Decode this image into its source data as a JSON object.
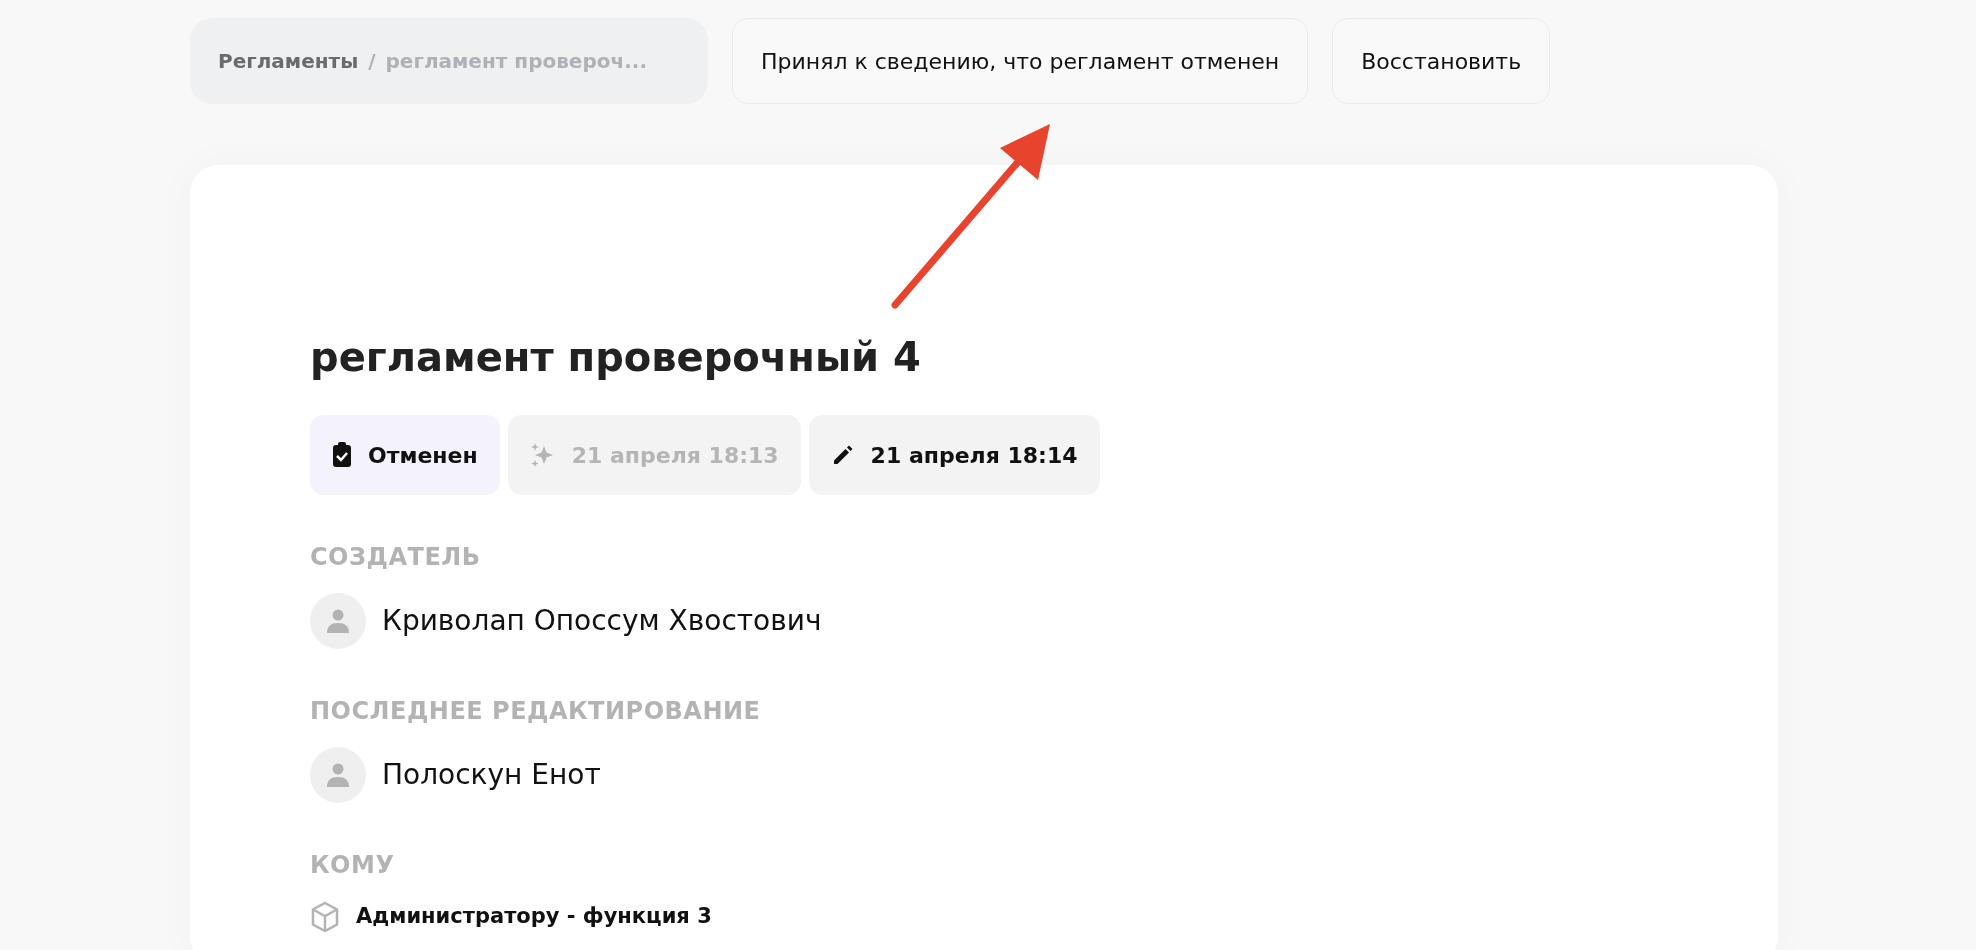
{
  "breadcrumb": [
    {
      "label": "Регламенты",
      "current": false
    },
    {
      "label": "регламент провероч...",
      "current": true
    }
  ],
  "separator": "/",
  "actions": [
    {
      "label": "Принял к сведению, что регламент отменен"
    },
    {
      "label": "Восстановить"
    }
  ],
  "document": {
    "title": "регламент проверочный 4",
    "badges": [
      {
        "kind": "status",
        "label": "Отменен",
        "muted": false
      },
      {
        "kind": "created",
        "label": "21 апреля 18:13",
        "muted": true
      },
      {
        "kind": "edited",
        "label": "21 апреля 18:14",
        "muted": false
      }
    ],
    "sections": [
      {
        "heading": "СОЗДАТЕЛЬ",
        "kind": "person",
        "value": "Криволап Опоссум Хвостович"
      },
      {
        "heading": "ПОСЛЕДНЕЕ РЕДАКТИРОВАНИЕ",
        "kind": "person",
        "value": "Полоскун Енот"
      },
      {
        "heading": "КОМУ",
        "kind": "role",
        "value": "Администратору - функция 3"
      }
    ]
  }
}
